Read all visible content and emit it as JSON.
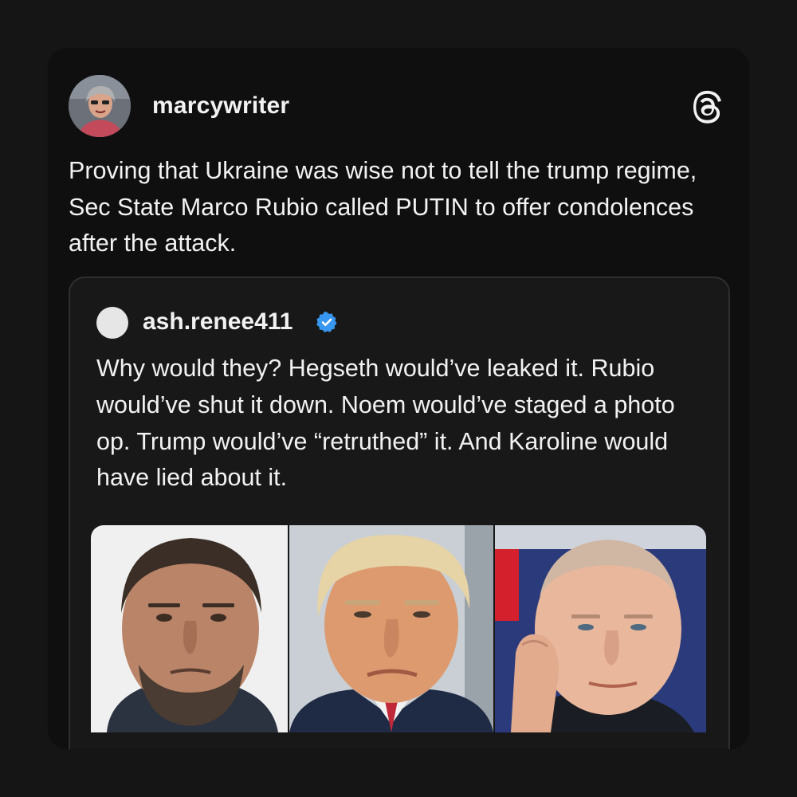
{
  "post": {
    "username": "marcywriter",
    "avatar_icon": "user-photo-avatar",
    "logo_icon": "threads-logo-icon",
    "text": "Proving that Ukraine was wise not to tell the trump regime, Sec State Marco Rubio called PUTIN to offer condolences after the attack."
  },
  "quote": {
    "username": "ash.renee411",
    "verified": true,
    "verified_color": "#3897f0",
    "text": "Why would they? Hegseth would’ve leaked it. Rubio would’ve shut it down. Noem would’ve staged a photo op. Trump would’ve “retruthed” it. And Karoline would have lied about it.",
    "photos": [
      {
        "subject": "portrait-photo-1"
      },
      {
        "subject": "portrait-photo-2"
      },
      {
        "subject": "portrait-photo-3"
      }
    ]
  },
  "colors": {
    "background": "#151515",
    "card": "#0f0f0f",
    "text": "#f2f2f2",
    "quote_border": "#2f2f2f"
  }
}
